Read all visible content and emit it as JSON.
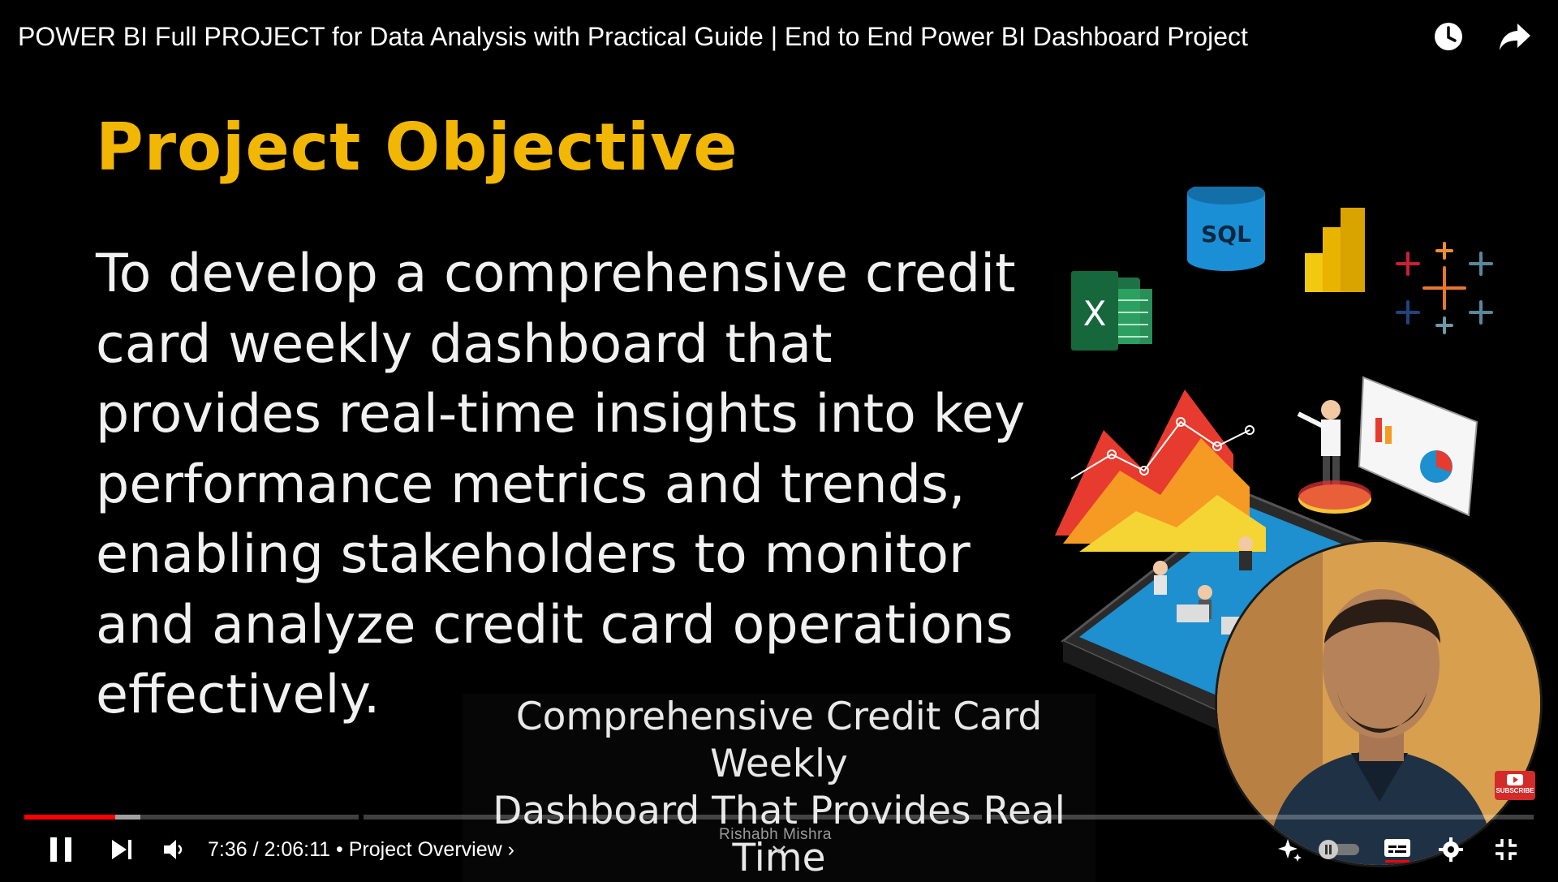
{
  "video": {
    "title": "POWER BI Full PROJECT for Data Analysis with Practical Guide | End to End Power BI Dashboard Project"
  },
  "top_icons": [
    "watch-later-icon",
    "share-icon"
  ],
  "slide": {
    "heading": "Project Objective",
    "body": "To develop a comprehensive credit card weekly dashboard that provides real-time insights into key performance metrics and trends, enabling stakeholders to monitor and analyze credit card operations effectively.",
    "heading_color": "#f2b705",
    "logos": {
      "excel": "X",
      "sql": "SQL"
    }
  },
  "captions": {
    "line1": "Comprehensive Credit Card Weekly",
    "line2": "Dashboard That Provides Real Time"
  },
  "watermark": "Rishabh Mishra",
  "subscribe": "SUBSCRIBE",
  "player": {
    "current_time": "7:36",
    "duration": "2:06:11",
    "chapter": "Project Overview",
    "progress_fraction": 0.06,
    "accent": "#ff0000"
  }
}
